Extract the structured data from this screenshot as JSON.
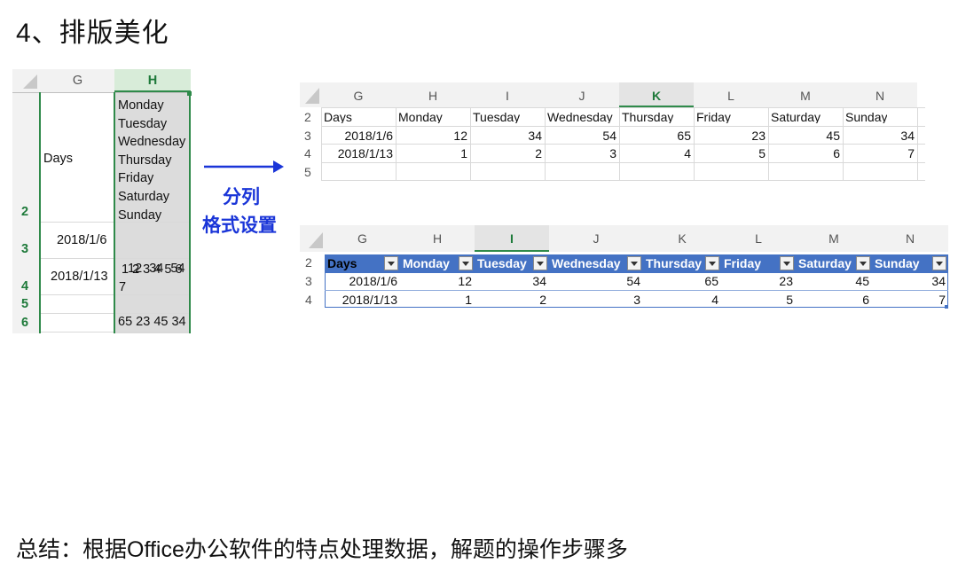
{
  "title": "4、排版美化",
  "footer": "总结：根据Office办公软件的特点处理数据，解题的操作步骤多",
  "arrow_label": [
    "分列",
    "格式设置"
  ],
  "left_sheet": {
    "col_headers": [
      "G",
      "H"
    ],
    "row_numbers": [
      "2",
      "3",
      "4",
      "5",
      "6"
    ],
    "g2": "Days",
    "h2_lines": [
      "Monday",
      "Tuesday",
      "Wednesday",
      "Thursday",
      "Friday",
      "Saturday",
      "Sunday"
    ],
    "g3": "2018/1/6",
    "h3_lines": [
      " 12  34  54",
      "65 23 45 34"
    ],
    "g4": "2018/1/13",
    "h4_lines": [
      "1 2 3 4 5 6",
      "7"
    ]
  },
  "top_sheet": {
    "col_headers": [
      "G",
      "H",
      "I",
      "J",
      "K",
      "L",
      "M",
      "N"
    ],
    "row_numbers": [
      "2",
      "3",
      "4",
      "5"
    ],
    "header_row": [
      "Days",
      "Monday",
      "Tuesday",
      "Wednesday",
      "Thursday",
      "Friday",
      "Saturday",
      "Sunday"
    ],
    "rows": [
      [
        "2018/1/6",
        "12",
        "34",
        "54",
        "65",
        "23",
        "45",
        "34"
      ],
      [
        "2018/1/13",
        "1",
        "2",
        "3",
        "4",
        "5",
        "6",
        "7"
      ]
    ]
  },
  "bottom_sheet": {
    "col_headers": [
      "G",
      "H",
      "I",
      "J",
      "K",
      "L",
      "M",
      "N"
    ],
    "row_numbers": [
      "2",
      "3",
      "4"
    ],
    "header_row": [
      "Days",
      "Monday",
      "Tuesday",
      "Wednesday",
      "Thursday",
      "Friday",
      "Saturday",
      "Sunday"
    ],
    "rows": [
      [
        "2018/1/6",
        "12",
        "34",
        "54",
        "65",
        "23",
        "45",
        "34"
      ],
      [
        "2018/1/13",
        "1",
        "2",
        "3",
        "4",
        "5",
        "6",
        "7"
      ]
    ]
  },
  "colors": {
    "accent_green": "#2f8a4a",
    "table_blue": "#4472c4",
    "arrow_blue": "#1a35d8"
  }
}
